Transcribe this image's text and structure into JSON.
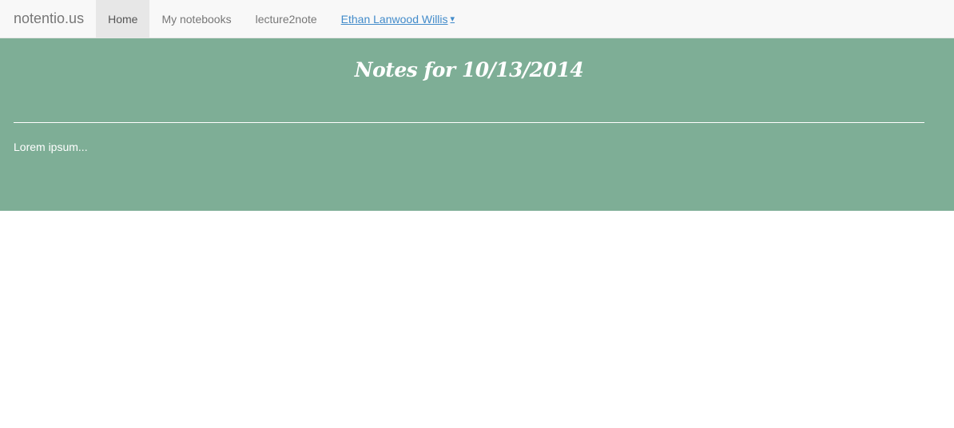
{
  "navbar": {
    "brand": "notentio.us",
    "items": [
      {
        "label": "Home",
        "active": true
      },
      {
        "label": "My notebooks",
        "active": false
      },
      {
        "label": "lecture2note",
        "active": false
      }
    ],
    "user": {
      "name": "Ethan Lanwood Willis",
      "caret_icon": "caret-down-icon",
      "caret": "▾"
    }
  },
  "note": {
    "title": "Notes for 10/13/2014",
    "body": "Lorem ipsum..."
  },
  "colors": {
    "navbar_bg": "#f8f8f8",
    "active_tab_bg": "#e7e7e7",
    "hero_bg": "#7eae96",
    "link": "#428bca",
    "text_light": "#ffffff"
  }
}
